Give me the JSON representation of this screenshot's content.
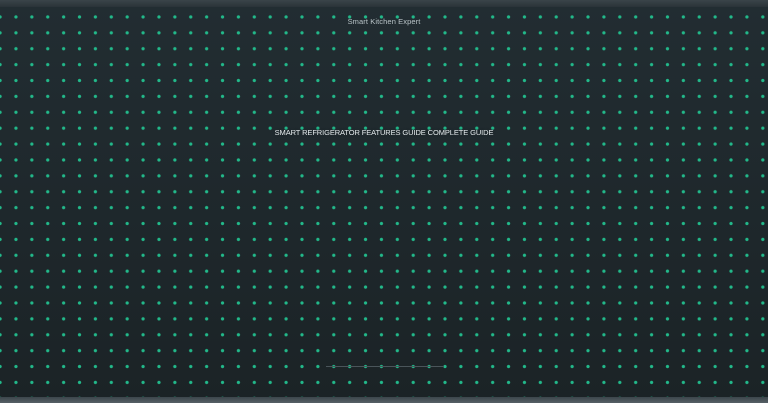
{
  "site": {
    "brand": "Smart Kitchen Expert"
  },
  "hero": {
    "headline": "SMART REFRIGERATOR FEATURES GUIDE COMPLETE GUIDE"
  },
  "colors": {
    "background": "#1e272b",
    "dot_accent": "#22b98a",
    "headline_text": "#e6ecee",
    "brand_text": "#b9c3c7"
  }
}
